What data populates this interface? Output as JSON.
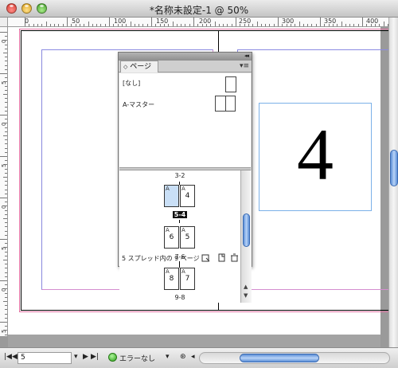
{
  "window": {
    "title": "*名称未設定-1 @ 50%"
  },
  "ruler": {
    "top_labels": [
      "0",
      "50",
      "100",
      "150",
      "200",
      "250",
      "300",
      "350",
      "400"
    ],
    "left_labels": [
      "0",
      "5",
      "0",
      "5",
      "0",
      "5",
      "0",
      "5"
    ]
  },
  "document": {
    "frame_text": "4"
  },
  "panel": {
    "tab_label": "ページ",
    "masters": {
      "none_label": "[なし]",
      "a_master_label": "A-マスター"
    },
    "spreads": [
      {
        "label": "3-2",
        "pages": [
          "",
          ""
        ]
      },
      {
        "label": "5-4",
        "pages": [
          "",
          "4"
        ],
        "selected": true
      },
      {
        "label": "7-6",
        "pages": [
          "6",
          "5"
        ]
      },
      {
        "label": "9-8",
        "pages": [
          "8",
          "7"
        ]
      }
    ],
    "page_prefix": "A",
    "footer_text": "5 スプレッド内の 9 ページ"
  },
  "status": {
    "page_value": "5",
    "preflight": "エラーなし"
  },
  "colors": {
    "scroll_accent": "#5c8fd8",
    "bleed": "#e070a0",
    "margin": "#8888dd",
    "frame": "#7bb0e8"
  }
}
